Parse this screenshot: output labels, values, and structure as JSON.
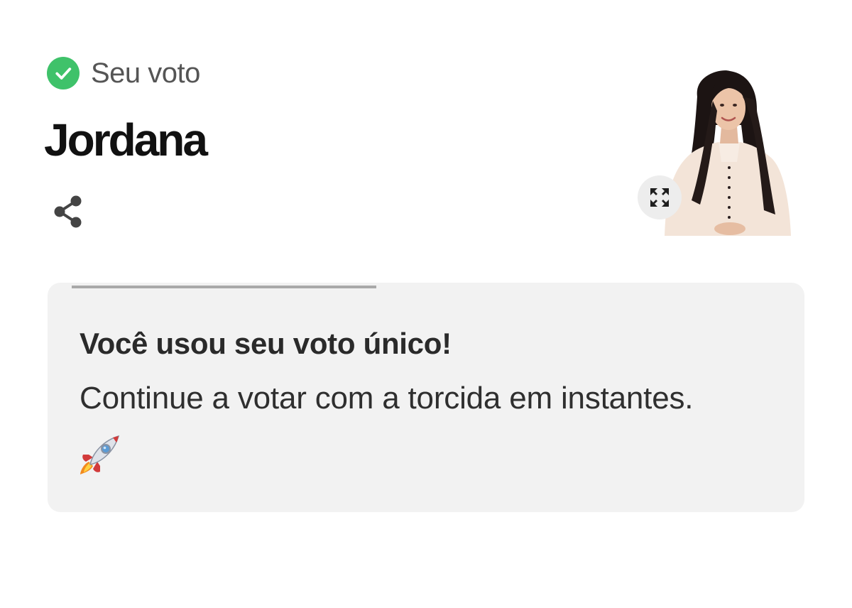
{
  "vote": {
    "status_label": "Seu voto",
    "status_icon": "check-circle-icon",
    "status_color": "#3fc26a"
  },
  "candidate": {
    "name": "Jordana",
    "photo_alt": "Jordana",
    "share_icon": "share-icon",
    "expand_icon": "expand-icon"
  },
  "notice": {
    "title": "Você usou seu voto único!",
    "message": "Continue a votar com a torcida em instantes.",
    "emoji_icon": "rocket-icon",
    "progress": 0.43
  }
}
